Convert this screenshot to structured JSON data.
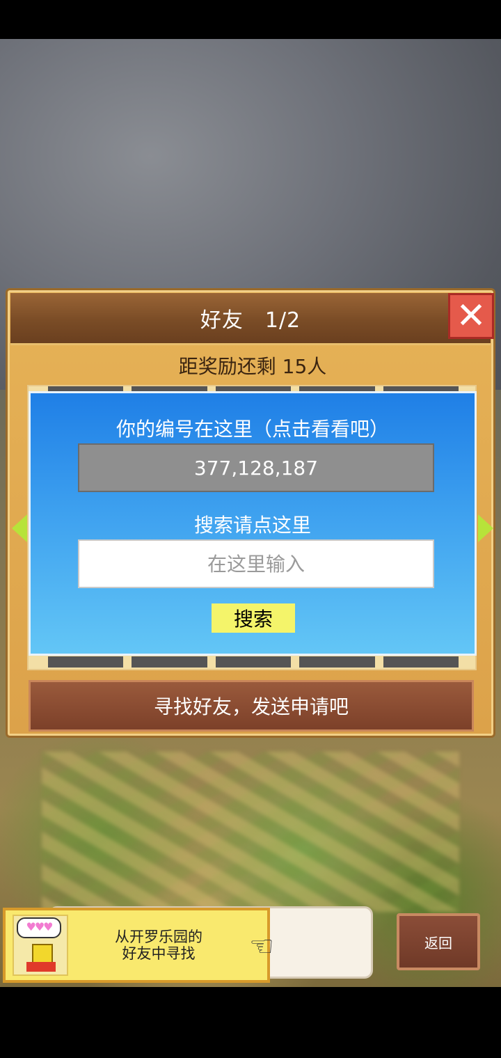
{
  "dialog": {
    "title": "好友　1/2",
    "close_icon": "close-icon",
    "reward_text": "距奖励还剩 15人",
    "id_label": "你的编号在这里（点击看看吧）",
    "id_value": "377,128,187",
    "search_label": "搜索请点这里",
    "search_placeholder": "在这里输入",
    "search_button": "搜索",
    "find_friends_button": "寻找好友，发送申请吧"
  },
  "banner": {
    "hearts": "♥♥♥",
    "text_line1": "从开罗乐园的",
    "text_line2": "好友中寻找"
  },
  "back_button": "返回",
  "colors": {
    "panel_blue": "#1f7fe6",
    "close_red": "#e55a4b",
    "search_button_yellow": "#f4f46a",
    "arrow_green": "#b7e33a"
  }
}
